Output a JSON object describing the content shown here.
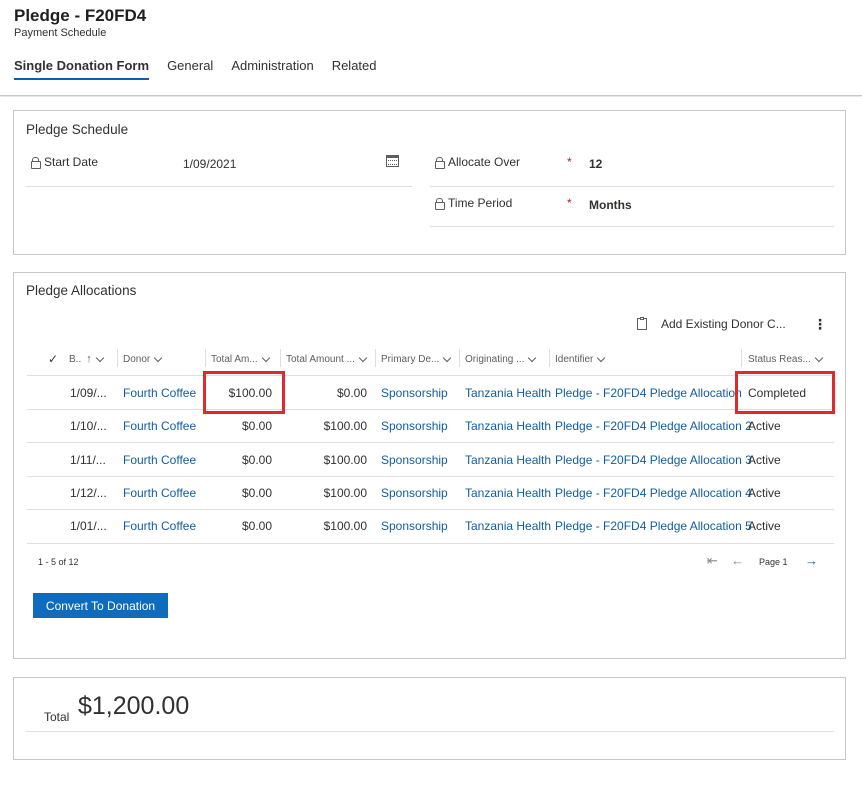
{
  "header": {
    "title": "Pledge - F20FD4",
    "subtitle": "Payment Schedule",
    "tabs": [
      "Single Donation Form",
      "General",
      "Administration",
      "Related"
    ]
  },
  "pledge_schedule": {
    "title": "Pledge Schedule",
    "start_date_label": "Start Date",
    "start_date_value": "1/09/2021",
    "allocate_over_label": "Allocate Over",
    "allocate_over_value": "12",
    "time_period_label": "Time Period",
    "time_period_value": "Months",
    "required_mark": "*"
  },
  "allocations": {
    "title": "Pledge Allocations",
    "add_existing_label": "Add Existing Donor C...",
    "more_label": "⋮",
    "columns": [
      "B..",
      "Donor",
      "Total Am...",
      "Total Amount ...",
      "Primary De...",
      "Originating ...",
      "Identifier",
      "Status Reas..."
    ],
    "rows": [
      {
        "b": "1/09/...",
        "donor": "Fourth Coffee",
        "total": "$100.00",
        "total2": "$0.00",
        "primary": "Sponsorship",
        "orig": "Tanzania Health",
        "identifier": "Pledge - F20FD4 Pledge Allocation",
        "status": "Completed"
      },
      {
        "b": "1/10/...",
        "donor": "Fourth Coffee",
        "total": "$0.00",
        "total2": "$100.00",
        "primary": "Sponsorship",
        "orig": "Tanzania Health",
        "identifier": "Pledge - F20FD4 Pledge Allocation 2",
        "status": "Active"
      },
      {
        "b": "1/11/...",
        "donor": "Fourth Coffee",
        "total": "$0.00",
        "total2": "$100.00",
        "primary": "Sponsorship",
        "orig": "Tanzania Health",
        "identifier": "Pledge - F20FD4 Pledge Allocation 3",
        "status": "Active"
      },
      {
        "b": "1/12/...",
        "donor": "Fourth Coffee",
        "total": "$0.00",
        "total2": "$100.00",
        "primary": "Sponsorship",
        "orig": "Tanzania Health",
        "identifier": "Pledge - F20FD4 Pledge Allocation 4",
        "status": "Active"
      },
      {
        "b": "1/01/...",
        "donor": "Fourth Coffee",
        "total": "$0.00",
        "total2": "$100.00",
        "primary": "Sponsorship",
        "orig": "Tanzania Health",
        "identifier": "Pledge - F20FD4 Pledge Allocation 5",
        "status": "Active"
      }
    ],
    "record_count": "1 - 5 of 12",
    "page_label": "Page 1",
    "convert_button": "Convert To Donation"
  },
  "total": {
    "label": "Total",
    "value": "$1,200.00"
  },
  "colors": {
    "accent": "#0f6cbd",
    "link": "#115ea3",
    "highlight": "#e02a2a"
  }
}
